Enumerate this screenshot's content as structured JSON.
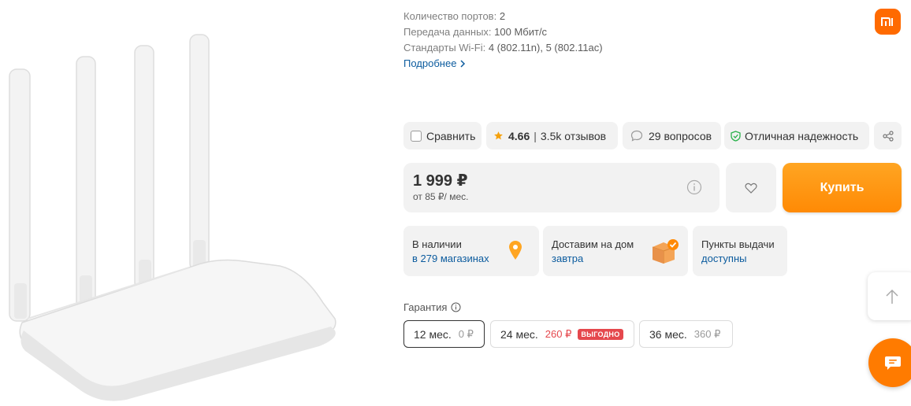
{
  "specs": [
    {
      "label": "Количество портов:",
      "value": "2"
    },
    {
      "label": "Передача данных:",
      "value": "100 Мбит/с"
    },
    {
      "label": "Стандарты Wi-Fi:",
      "value": "4 (802.11n), 5 (802.11ac)"
    }
  ],
  "more_link": "Подробнее",
  "brand": {
    "logo_text": "mi",
    "color": "#ff6a00"
  },
  "actions": {
    "compare": "Сравнить",
    "rating": "4.66",
    "reviews": "3.5k отзывов",
    "questions": "29 вопросов",
    "reliability": "Отличная надежность"
  },
  "price": {
    "main": "1 999 ₽",
    "credit": "от 85 ₽/ мес."
  },
  "buy_label": "Купить",
  "availability": [
    {
      "title": "В наличии",
      "link": "в 279 магазинах",
      "icon": "location-pin-icon"
    },
    {
      "title": "Доставим на дом",
      "link": "завтра",
      "icon": "delivery-box-icon"
    },
    {
      "title": "Пункты выдачи",
      "link": "доступны"
    }
  ],
  "warranty": {
    "label": "Гарантия",
    "options": [
      {
        "term": "12 мес.",
        "price": "0 ₽",
        "selected": true
      },
      {
        "term": "24 мес.",
        "price": "260 ₽",
        "badge": "ВЫГОДНО"
      },
      {
        "term": "36 мес.",
        "price": "360 ₽"
      }
    ]
  },
  "colors": {
    "accent": "#ff8a05",
    "link": "#0b5b9e",
    "pill_bg": "#f2f2f2",
    "badge_red": "#e5484d",
    "reliability_green": "#2bb24c",
    "star": "#f5a10c"
  }
}
